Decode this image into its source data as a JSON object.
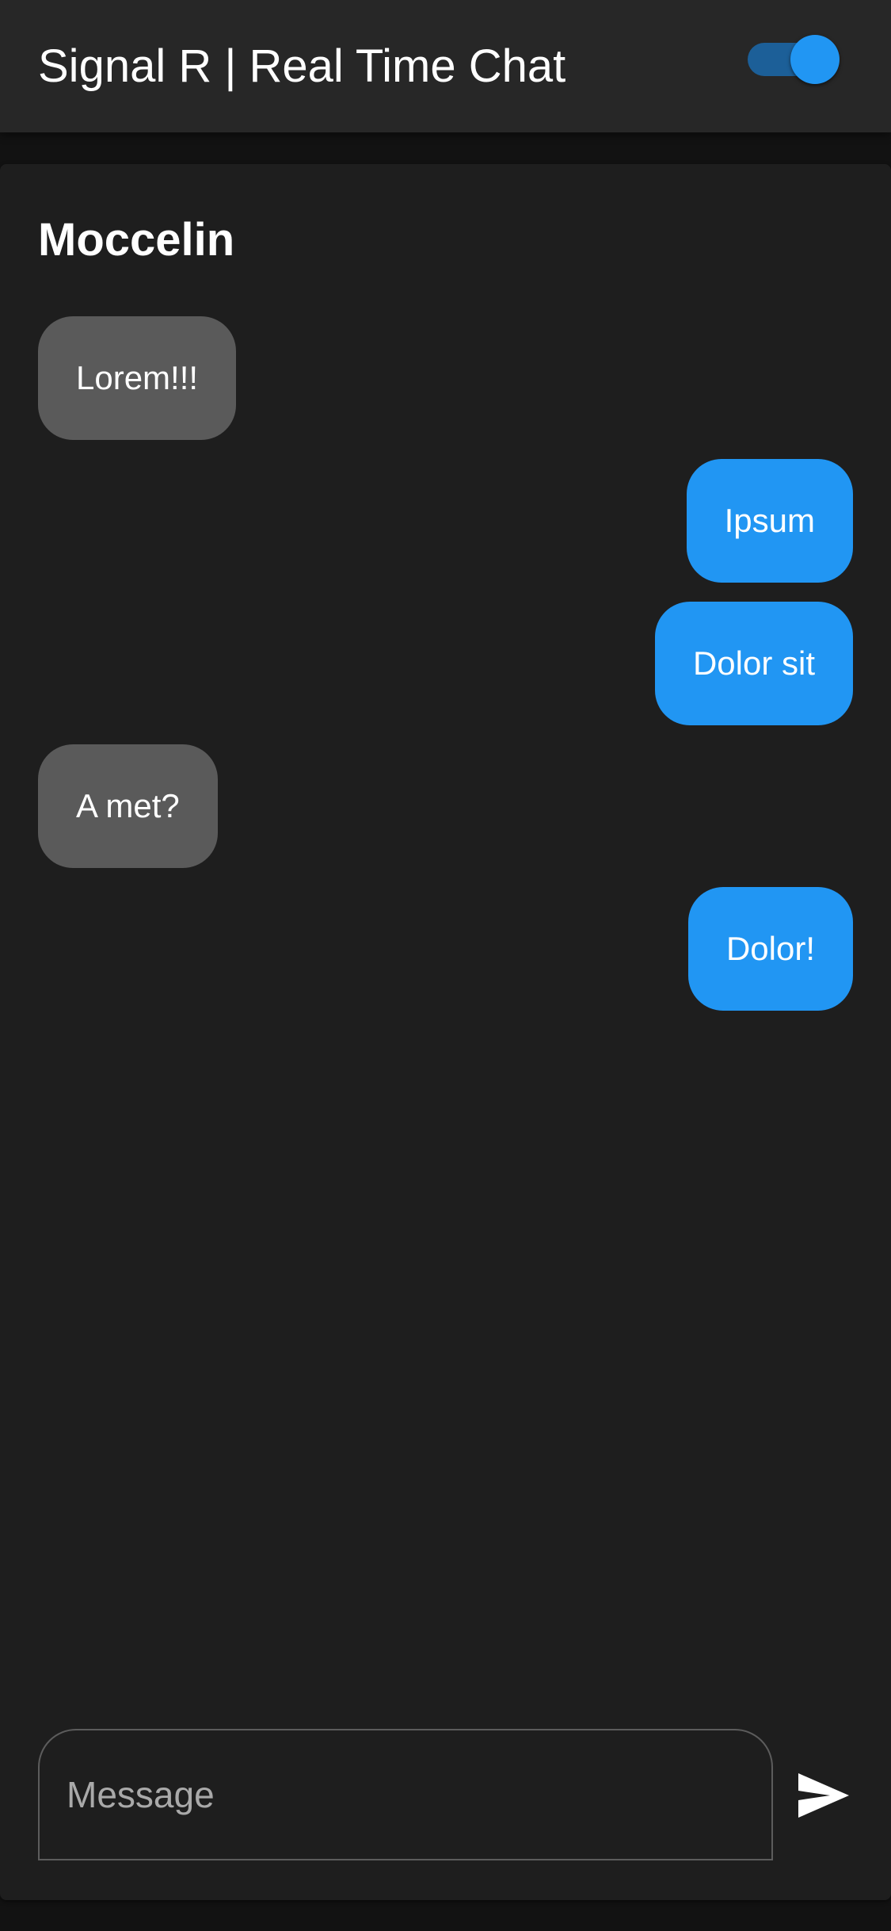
{
  "app_bar": {
    "title": "Signal R | Real Time Chat",
    "theme_toggle": {
      "on": true,
      "icon": "toggle-switch-icon"
    }
  },
  "chat": {
    "contact_name": "Moccelin",
    "messages": [
      {
        "direction": "incoming",
        "text": "Lorem!!!"
      },
      {
        "direction": "outgoing",
        "text": "Ipsum"
      },
      {
        "direction": "outgoing",
        "text": "Dolor sit"
      },
      {
        "direction": "incoming",
        "text": "A met?"
      },
      {
        "direction": "outgoing",
        "text": "Dolor!"
      }
    ]
  },
  "composer": {
    "placeholder": "Message",
    "value": "",
    "send_icon": "send-icon"
  },
  "colors": {
    "accent": "#2196f3",
    "incoming_bubble": "#5a5a5a",
    "card_bg": "#1e1e1e",
    "app_bar_bg": "#272727",
    "page_bg": "#121212"
  }
}
